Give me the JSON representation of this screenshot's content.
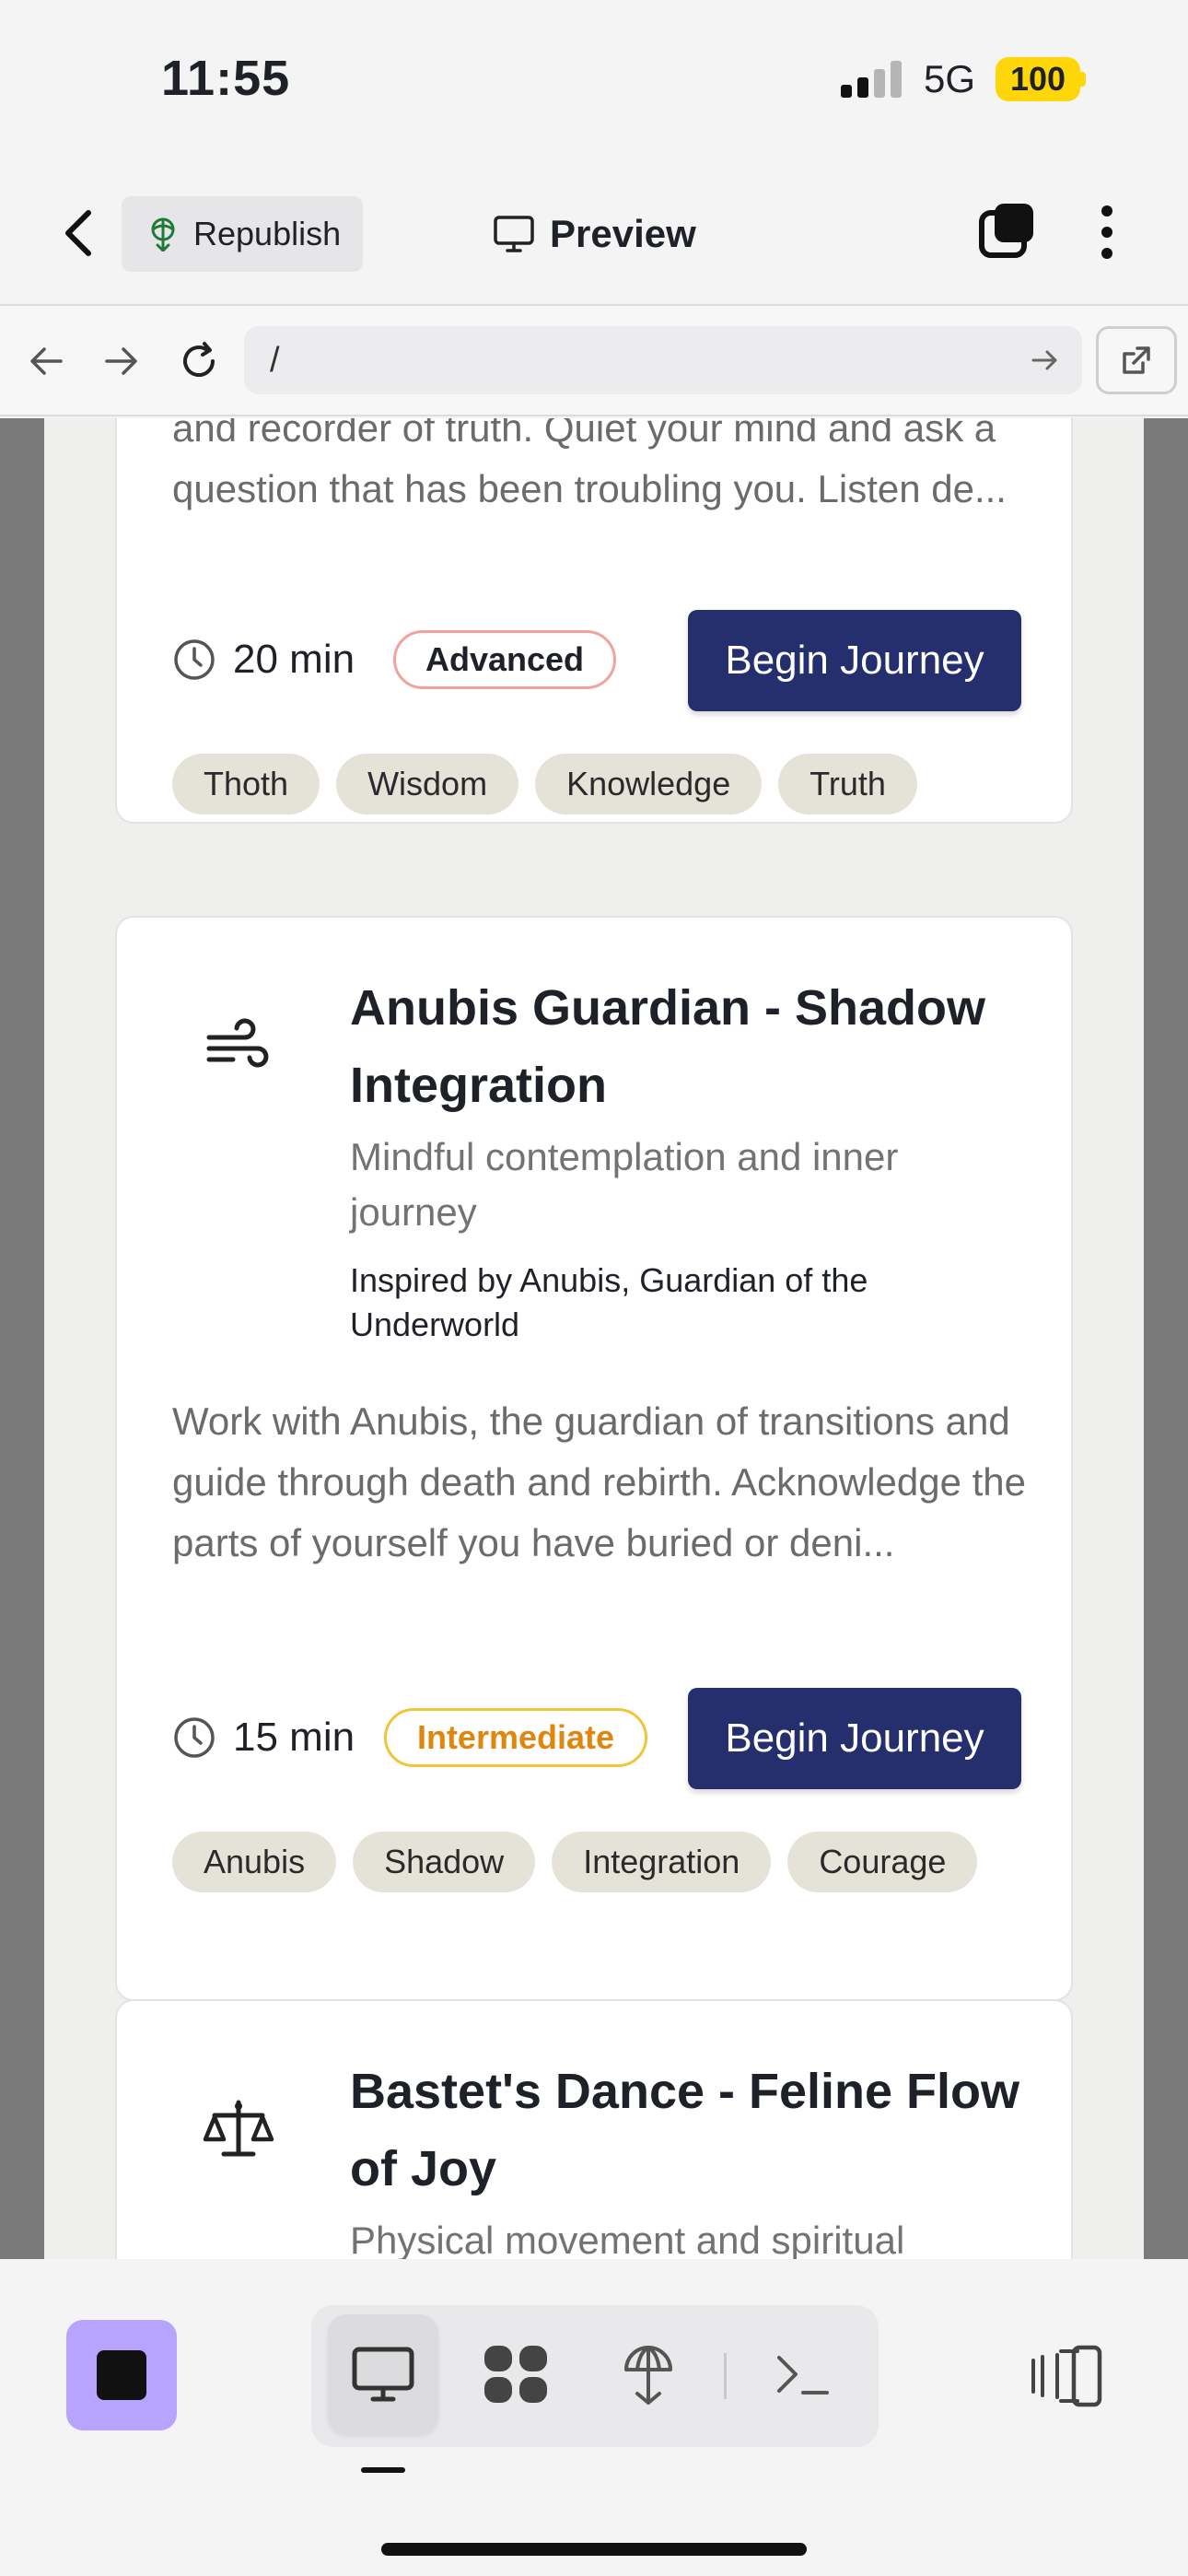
{
  "status_bar": {
    "time": "11:55",
    "network": "5G",
    "battery": "100"
  },
  "header": {
    "republish_label": "Republish",
    "preview_label": "Preview"
  },
  "url_bar": {
    "url": "/"
  },
  "cards": [
    {
      "description": "and recorder of truth. Quiet your mind and ask a question that has been troubling you. Listen de...",
      "duration": "20 min",
      "level": "Advanced",
      "button": "Begin Journey",
      "tags": [
        "Thoth",
        "Wisdom",
        "Knowledge",
        "Truth"
      ]
    },
    {
      "icon": "wind-icon",
      "title": "Anubis Guardian - Shadow Integration",
      "subtitle": "Mindful contemplation and inner journey",
      "inspired": "Inspired by Anubis, Guardian of the Underworld",
      "description": "Work with Anubis, the guardian of transitions and guide through death and rebirth. Acknowledge the parts of yourself you have buried or deni...",
      "duration": "15 min",
      "level": "Intermediate",
      "button": "Begin Journey",
      "tags": [
        "Anubis",
        "Shadow",
        "Integration",
        "Courage"
      ]
    },
    {
      "icon": "scales-icon",
      "title": "Bastet's Dance - Feline Flow of Joy",
      "subtitle": "Physical movement and spiritual"
    }
  ],
  "toolbar": {
    "modes": [
      "desktop-preview-icon",
      "components-icon",
      "publish-icon",
      "terminal-icon"
    ],
    "active_mode": "desktop-preview-icon"
  }
}
